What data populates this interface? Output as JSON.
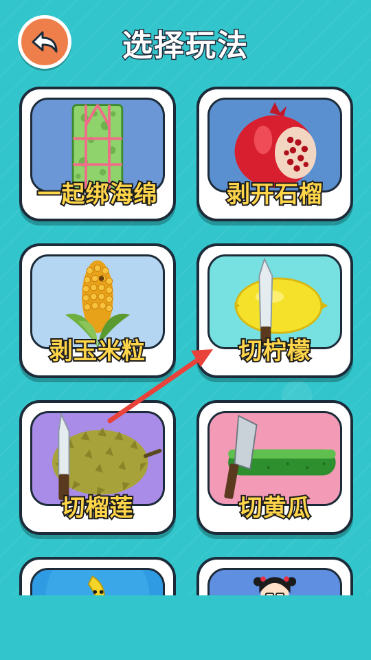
{
  "header": {
    "title": "选择玩法"
  },
  "colors": {
    "background": "#32c6cc",
    "label_fill": "#ffd54a",
    "back_button": "#ef7f4a"
  },
  "modes": [
    {
      "label": "一起绑海绵",
      "icon": "sponge-tied-icon",
      "bg": "#6b97d6"
    },
    {
      "label": "剥开石榴",
      "icon": "pomegranate-icon",
      "bg": "#5b90d0"
    },
    {
      "label": "剥玉米粒",
      "icon": "corn-icon",
      "bg": "#b5d6f2"
    },
    {
      "label": "切柠檬",
      "icon": "lemon-knife-icon",
      "bg": "#77e0e0"
    },
    {
      "label": "切榴莲",
      "icon": "durian-knife-icon",
      "bg": "#a98ce8"
    },
    {
      "label": "切黄瓜",
      "icon": "cucumber-knife-icon",
      "bg": "#f39bb6"
    },
    {
      "label": "",
      "icon": "banana-icon",
      "bg": "#2f9be3"
    },
    {
      "label": "",
      "icon": "girl-character-icon",
      "bg": "#5f8fe0"
    }
  ]
}
